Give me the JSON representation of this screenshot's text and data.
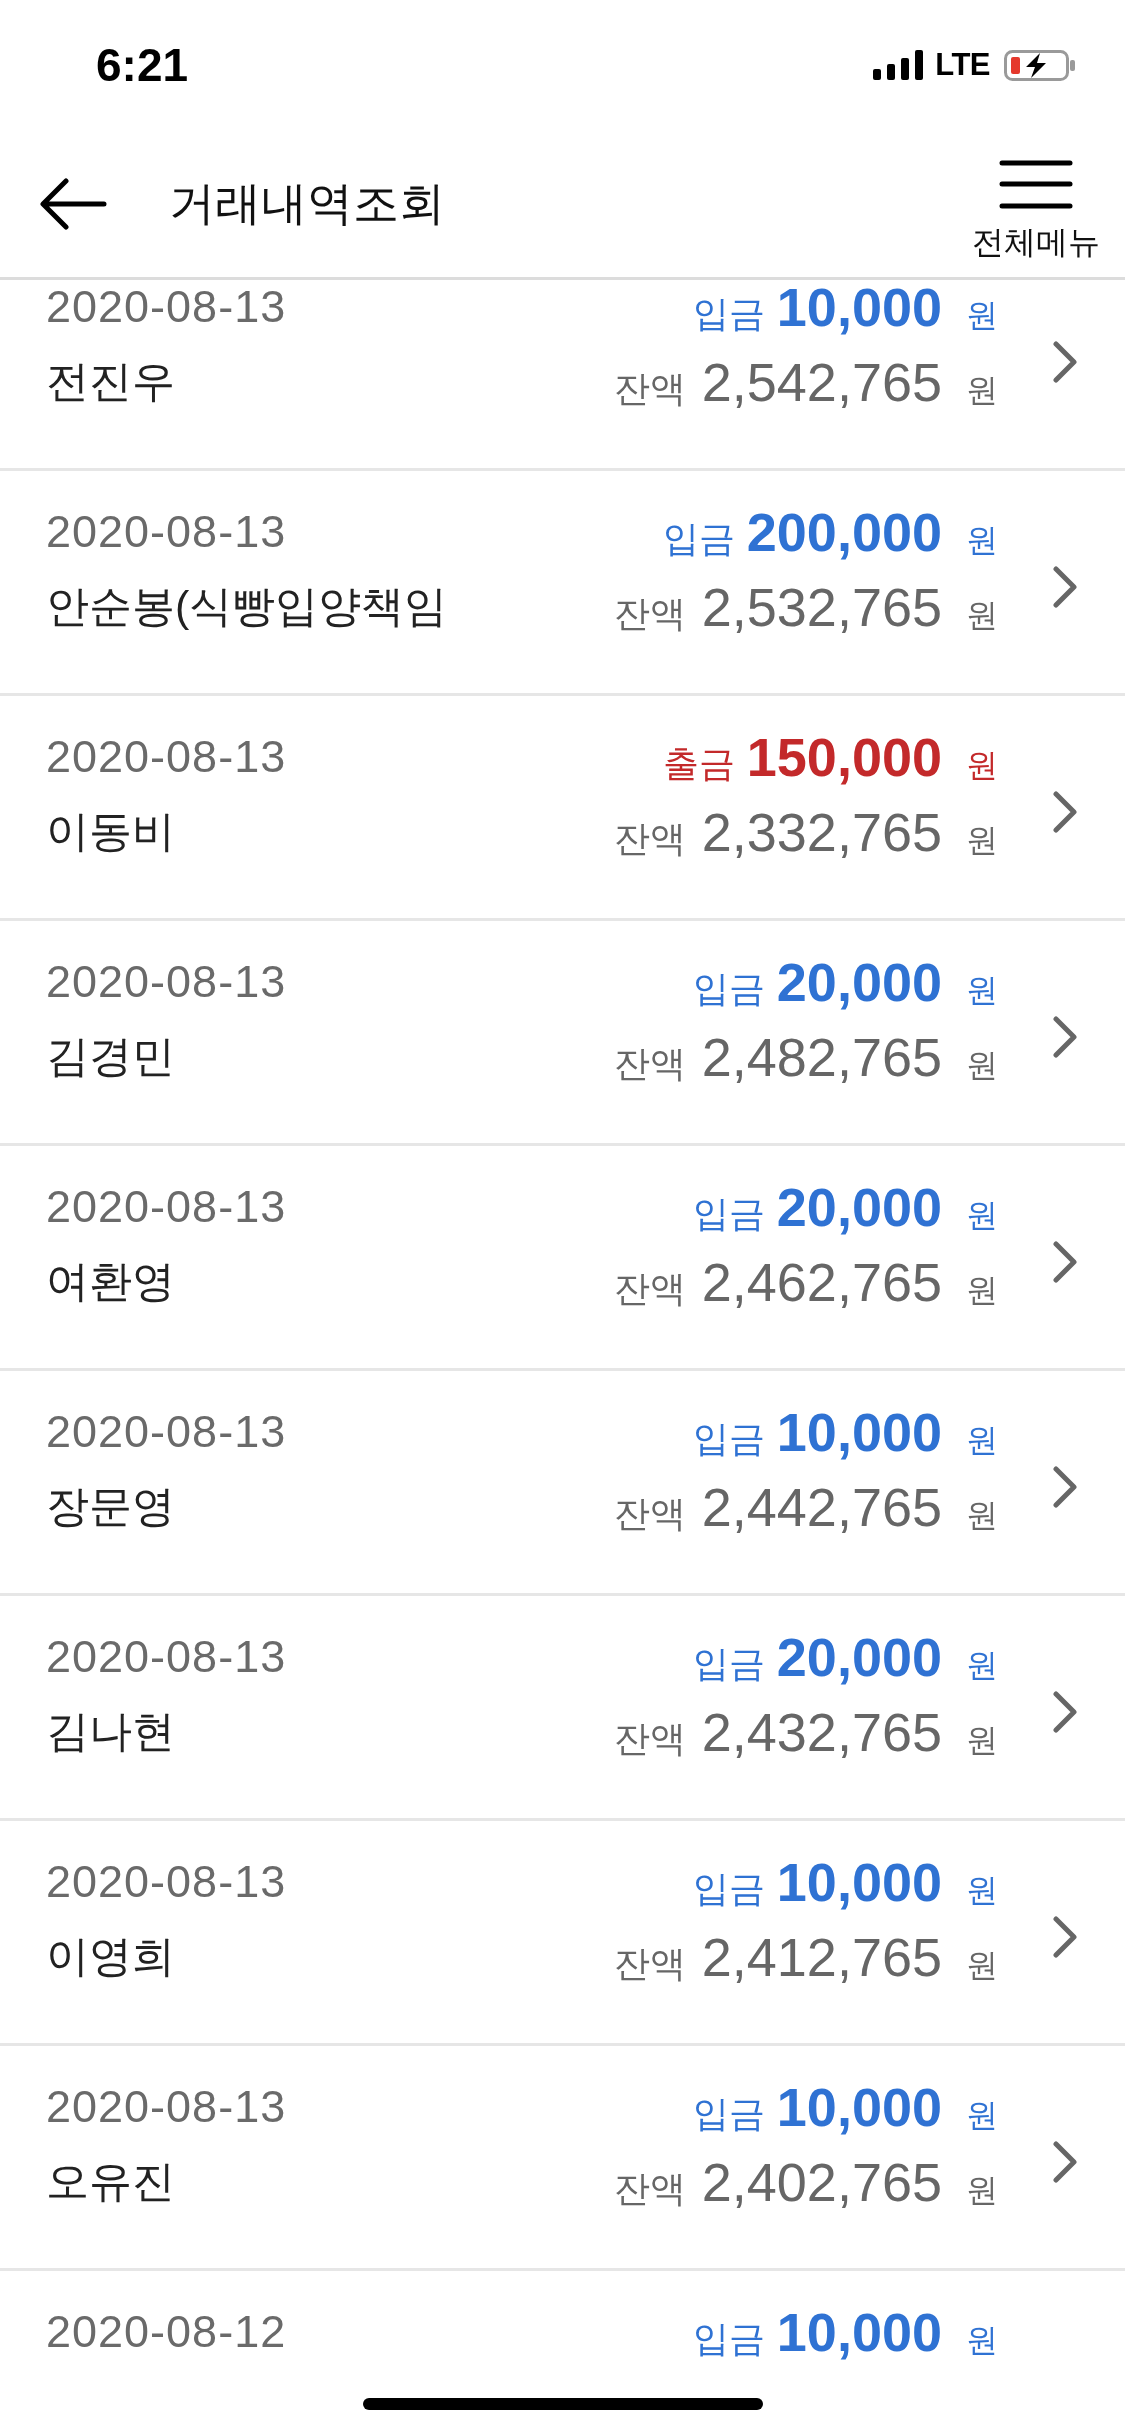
{
  "status_bar": {
    "time": "6:21",
    "network": "LTE"
  },
  "header": {
    "title": "거래내역조회",
    "menu_label": "전체메뉴"
  },
  "transactions": [
    {
      "date": "2020-08-13",
      "name": "전진우",
      "kind": "deposit",
      "type_label": "입금",
      "amount": "10,000",
      "currency": "원",
      "balance_label": "잔액",
      "balance": "2,542,765",
      "balance_currency": "원"
    },
    {
      "date": "2020-08-13",
      "name": "안순봉(식빵입양책임",
      "kind": "deposit",
      "type_label": "입금",
      "amount": "200,000",
      "currency": "원",
      "balance_label": "잔액",
      "balance": "2,532,765",
      "balance_currency": "원"
    },
    {
      "date": "2020-08-13",
      "name": "이동비",
      "kind": "withdrawal",
      "type_label": "출금",
      "amount": "150,000",
      "currency": "원",
      "balance_label": "잔액",
      "balance": "2,332,765",
      "balance_currency": "원"
    },
    {
      "date": "2020-08-13",
      "name": "김경민",
      "kind": "deposit",
      "type_label": "입금",
      "amount": "20,000",
      "currency": "원",
      "balance_label": "잔액",
      "balance": "2,482,765",
      "balance_currency": "원"
    },
    {
      "date": "2020-08-13",
      "name": "여환영",
      "kind": "deposit",
      "type_label": "입금",
      "amount": "20,000",
      "currency": "원",
      "balance_label": "잔액",
      "balance": "2,462,765",
      "balance_currency": "원"
    },
    {
      "date": "2020-08-13",
      "name": "장문영",
      "kind": "deposit",
      "type_label": "입금",
      "amount": "10,000",
      "currency": "원",
      "balance_label": "잔액",
      "balance": "2,442,765",
      "balance_currency": "원"
    },
    {
      "date": "2020-08-13",
      "name": "김나현",
      "kind": "deposit",
      "type_label": "입금",
      "amount": "20,000",
      "currency": "원",
      "balance_label": "잔액",
      "balance": "2,432,765",
      "balance_currency": "원"
    },
    {
      "date": "2020-08-13",
      "name": "이영희",
      "kind": "deposit",
      "type_label": "입금",
      "amount": "10,000",
      "currency": "원",
      "balance_label": "잔액",
      "balance": "2,412,765",
      "balance_currency": "원"
    },
    {
      "date": "2020-08-13",
      "name": "오유진",
      "kind": "deposit",
      "type_label": "입금",
      "amount": "10,000",
      "currency": "원",
      "balance_label": "잔액",
      "balance": "2,402,765",
      "balance_currency": "원"
    },
    {
      "date": "2020-08-12",
      "kind": "deposit",
      "type_label": "입금",
      "amount": "10,000",
      "currency": "원"
    }
  ]
}
